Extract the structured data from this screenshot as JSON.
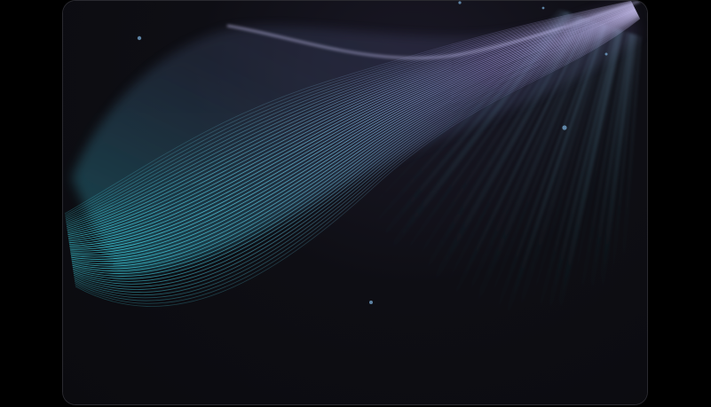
{
  "colors": {
    "page_background": "#000000",
    "screen_background": "#0d0d12",
    "wave_cyan": "#3fe0f0",
    "wave_teal": "#2aa7b5",
    "wave_violet": "#8f86c8",
    "wave_purple": "#5a4f7e"
  },
  "visual": {
    "subject": "abstract-flowing-light-strands",
    "particles": 6
  }
}
